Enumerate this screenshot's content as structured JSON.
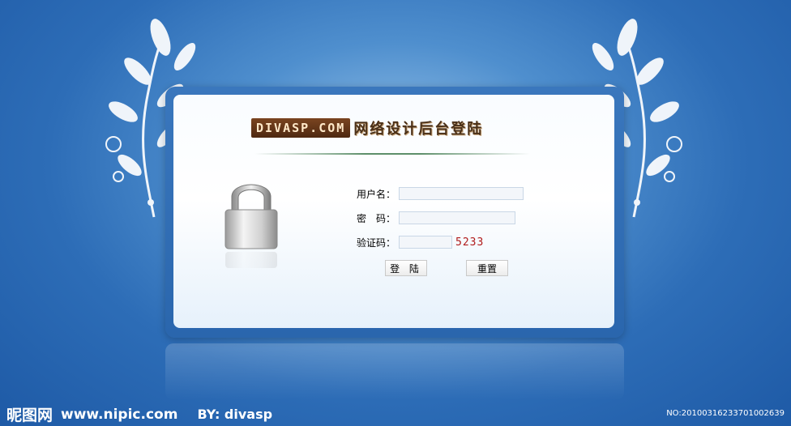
{
  "header": {
    "brand": "DIVASP.COM",
    "title": "网络设计后台登陆"
  },
  "login_form": {
    "username_label": "用户名：",
    "username_value": "",
    "password_label": "密　码：",
    "password_value": "",
    "captcha_label": "验证码：",
    "captcha_value": "",
    "captcha_code": "5233",
    "login_button": "登 陆",
    "reset_button": "重置"
  },
  "footer": {
    "site_name": "昵图网",
    "site_url": "www.nipic.com",
    "author": "BY: divasp",
    "image_number": "NO:20100316233701002639"
  },
  "colors": {
    "background": "#2d6db7",
    "panel_border": "#3a77bd",
    "brand_bg": "#5e3316",
    "captcha_text": "#b01a1a"
  },
  "icons": [
    "padlock-icon",
    "leaf-ornament-left",
    "leaf-ornament-right"
  ]
}
